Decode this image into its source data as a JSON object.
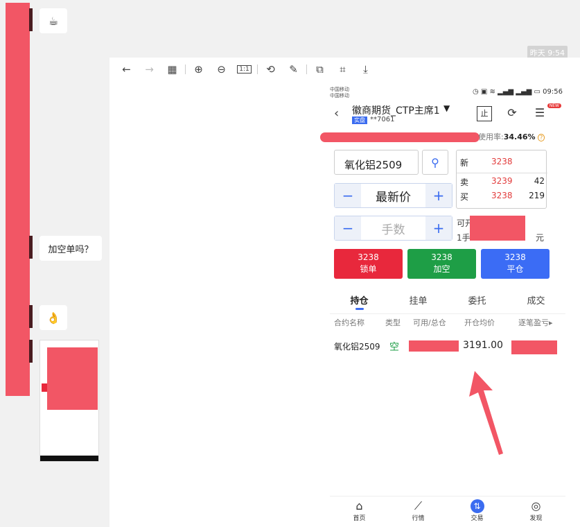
{
  "chat": {
    "emoji_1": "☕",
    "question": "加空单吗？",
    "emoji_2": "👌",
    "timestamp": "昨天 9:54"
  },
  "toolbar": {
    "icons": [
      "back-arrow-icon",
      "forward-arrow-icon",
      "grid-icon",
      "zoom-in-icon",
      "zoom-out-icon",
      "actual-size-icon",
      "rotate-icon",
      "edit-icon",
      "copy-icon",
      "scan-icon",
      "download-icon"
    ],
    "actual_size_label": "1:1"
  },
  "phone": {
    "carrier_1": "中国移动",
    "carrier_2": "中国移动",
    "time": "09:56",
    "broker": "徽商期货_CTP主席1",
    "live_tag": "实盘",
    "account": "**7061",
    "new_badge": "NEW",
    "usage_label": "使用率:",
    "usage_value": "34.46%",
    "help": "?",
    "symbol": "氧化铝2509",
    "price_mode": "最新价",
    "qty_placeholder": "手数",
    "minus": "−",
    "plus": "+",
    "quote": {
      "new_label": "新",
      "new_price": "3238",
      "ask_label": "卖",
      "ask_price": "3239",
      "ask_qty": "42",
      "bid_label": "买",
      "bid_price": "3238",
      "bid_qty": "219"
    },
    "avail_1": "可开",
    "avail_2_prefix": "1手",
    "avail_2_suffix": "元",
    "buttons": [
      {
        "price": "3238",
        "label": "锁单",
        "color": "#e8283c"
      },
      {
        "price": "3238",
        "label": "加空",
        "color": "#1e9e46"
      },
      {
        "price": "3238",
        "label": "平仓",
        "color": "#3b6cf5"
      }
    ],
    "tabs": [
      "持仓",
      "挂单",
      "委托",
      "成交"
    ],
    "columns": [
      "合约名称",
      "类型",
      "可用/总仓",
      "开仓均价",
      "逐笔盈亏▸"
    ],
    "position": {
      "name": "氧化铝2509",
      "type": "空",
      "avg_price": "3191.00"
    },
    "nav": [
      {
        "label": "首页",
        "icon": "home-icon"
      },
      {
        "label": "行情",
        "icon": "chart-icon"
      },
      {
        "label": "交易",
        "icon": "trade-icon"
      },
      {
        "label": "发现",
        "icon": "compass-icon"
      }
    ]
  },
  "colors": {
    "redaction": "#f25665",
    "accent": "#3b6cf0",
    "up_red": "#e23c3c",
    "short_green": "#1e9e46"
  }
}
